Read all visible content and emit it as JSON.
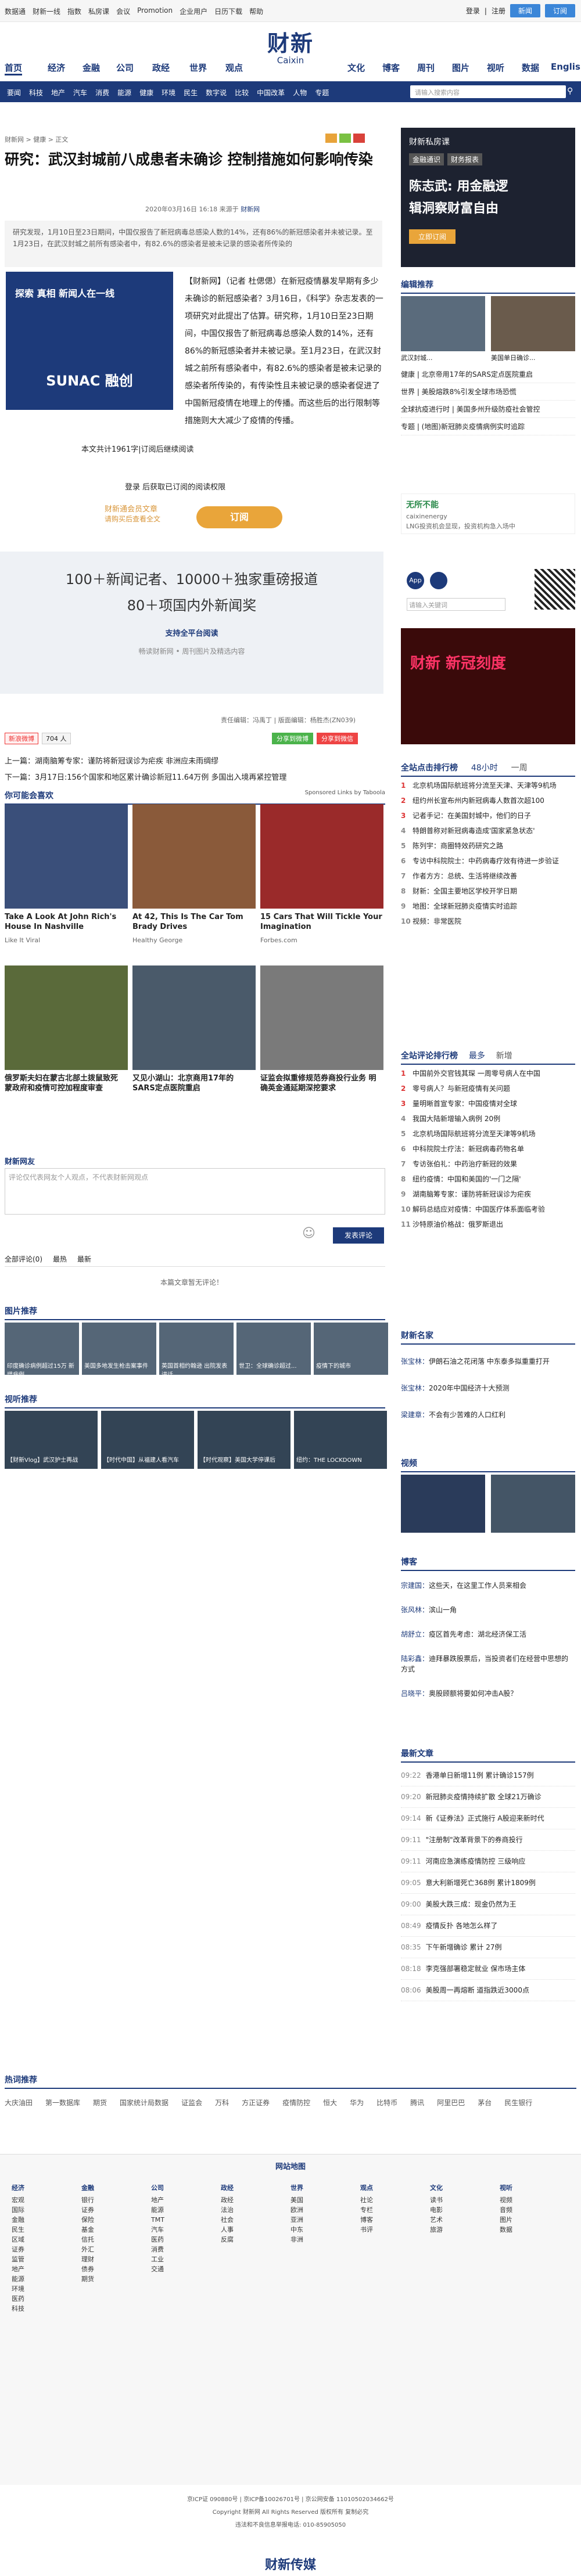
{
  "topbar": {
    "links": [
      "数据通",
      "财新一线",
      "指数",
      "私房课",
      "会议",
      "Promotion",
      "企业用户",
      "日历下载",
      "帮助"
    ],
    "login": "登录",
    "register": "注册",
    "btn1": "新闻",
    "btn2": "订阅"
  },
  "logo": {
    "cn": "财新",
    "en": "Caixin"
  },
  "nav1": [
    "首页",
    "经济",
    "金融",
    "公司",
    "政经",
    "世界",
    "观点",
    "文化",
    "博客",
    "周刊",
    "图片",
    "视听",
    "数据",
    "English"
  ],
  "nav2": {
    "items": [
      "要闻",
      "科技",
      "地产",
      "汽车",
      "消费",
      "能源",
      "健康",
      "环境",
      "民生",
      "数字说",
      "比较",
      "中国改革",
      "人物",
      "专题"
    ],
    "search_placeholder": "请输入搜索内容"
  },
  "article": {
    "breadcrumb": "财新网 > 健康 > 正文",
    "title": "研究：武汉封城前八成患者未确诊 控制措施如何影响传染",
    "meta": "2020年03月16日 16:18 来源于",
    "meta_src": "财新网",
    "summary": "研究发现，1月10日至23日期间，中国仅报告了新冠病毒总感染人数的14%，还有86%的新冠感染者并未被记录。至1月23日，在武汉封城之前所有感染者中，有82.6%的感染者是被未记录的感染者所传染的",
    "lead": "【财新网】（记者 杜偲偲）在新冠疫情暴发早期有多少未确诊的新冠感染者？3月16日，《科学》杂志发表的一项研究对此提出了估算。研究称，1月10日至23日期间，中国仅报告了新冠病毒总感染人数的14%，还有86%的新冠感染者并未被记录。至1月23日，在武汉封城之前所有感染者中，有82.6%的感染者是被未记录的感染者所传染的，有传染性且未被记录的感染者促进了中国新冠疫情在地理上的传播。而这些后的出行限制等措施则大大减少了疫情的传播。",
    "ad_text": "探索 真相 新闻人在一线",
    "ad_brand": "SUNAC 融创",
    "count_line": "本文共计1961字|订阅后继续阅读",
    "login_line": "登录 后获取已订阅的阅读权限",
    "sub_big": "财新通会员文章",
    "sub_small": "请购买后查看全文",
    "sub_btn": "订阅",
    "promo1": "100＋新闻记者、10000＋独家重磅报道",
    "promo2": "80＋项国内外新闻奖",
    "promo3": "支持全平台阅读",
    "promo4": "畅读财新网 • 周刊图片及精选内容",
    "editor": "责任编辑：冯禹丁 | 版面编辑：杨胜杰(ZN039)",
    "share1": "分享到微博",
    "share2": "分享到微信",
    "prev": "上一篇：",
    "prev_txt": "湖南脑筹专家：谨防将新冠误诊为疟疾 非洲应未雨绸缪",
    "next": "下一篇：",
    "next_txt": "3月17日:156个国家和地区累计确诊新冠11.64万例 多国出入境再紧控管理",
    "recommend": "你可能会喜欢",
    "sponsored": "Sponsored Links by Taboola"
  },
  "recs": [
    {
      "t": "Take A Look At John Rich's House In Nashville",
      "s": "Like It Viral"
    },
    {
      "t": "At 42, This Is The Car Tom Brady Drives",
      "s": "Healthy George"
    },
    {
      "t": "15 Cars That Will Tickle Your Imagination",
      "s": "Forbes.com"
    },
    {
      "t": "俄罗斯夫妇在蒙古北部土拨鼠致死 蒙政府和疫情可控加程度审查",
      "s": ""
    },
    {
      "t": "又见小湖山：北京商用17年的SARS定点医院重启",
      "s": ""
    },
    {
      "t": "证监会拟重修规范券商投行业务 明确英金通延期深挖要求",
      "s": ""
    }
  ],
  "comments": {
    "title": "财新网友",
    "placeholder": "评论仅代表网友个人观点，不代表财新网观点",
    "submit": "发表评论",
    "tabs": [
      "全部评论(0)",
      "最热",
      "最新"
    ],
    "none": "本篇文章暂无评论！"
  },
  "pic_section": "图片推荐",
  "video_section": "视听推荐",
  "pics": [
    "印度确诊病例超过15万 新增病例",
    "美国多地发生枪击案事件",
    "英国首相约翰逊 出院发表讲话",
    "世卫：全球确诊超过...",
    "疫情下的城市"
  ],
  "videos": [
    "【财新Vlog】武汉护士再战",
    "【时代中国】从福建人看汽车",
    "【时代观察】美国大学停课后",
    "纽约：THE LOCKDOWN"
  ],
  "right": {
    "ad_title": "财新私房课",
    "ad_big1": "陈志武: 用金融逻",
    "ad_big2": "辑洞察财富自由",
    "ad_badge1": "金融通识",
    "ad_badge2": "财务报表",
    "ad_btn": "立即订阅",
    "editors": "编辑推荐",
    "ed_caps": [
      "武汉封城...",
      "美国单日确诊..."
    ],
    "ed_list": [
      "健康 | 北京帝用17年的SARS定点医院重启",
      "世界 | 美股熔跌8%引发全球市场恐慌",
      "全球抗疫进行时 | 美国多州升级防疫社会管控",
      "专题 | (地图)新冠肺炎疫情病例实时追踪"
    ],
    "app": "无所不能",
    "app2": "caixinenergy",
    "app3": "LNG投资机会显现，投资机构急入场中",
    "qr_text": "请输入关键词",
    "hot_title": "财新 新冠刻度",
    "rank": "全站点击排行榜",
    "rank_tabs": [
      "48小时",
      "一周"
    ],
    "rank_list": [
      "北京机场国际航班将分流至天津、天津等9机场",
      "纽约州长宣布州内新冠病毒人数首次超100",
      "记者手记：在美国封城中，他们的日子",
      "特朗普称对新冠病毒造成'国家紧急状态'",
      "陈列宇：商圈特效药研究之路",
      "专访中科院院士：中药病毒疗效有待进一步验证",
      "作者方方：总统、生活将继续改善",
      "财新：全国主要地区学校开学日期",
      "地图：全球新冠肺炎疫情实时追踪",
      "视频：非常医院"
    ],
    "cmt_rank": "全站评论排行榜",
    "cmt_tabs": [
      "最多",
      "新增"
    ],
    "cmt_list": [
      "中国前外交官钱其琛 一周零号病人在中国",
      "零号病人？与新冠疫情有关问题",
      "量明晰首宣专家：中国疫情对全球",
      "我国大陆新增输入病例 20例",
      "北京机场国际航班将分流至天津等9机场",
      "中科院院士疗法：新冠病毒药物名单",
      "专访张伯礼：中药治疗新冠的效果",
      "纽约疫情：中国和美国的'一门之隔'",
      "湖南脑筹专家：谨防将新冠误诊为疟疾",
      "解码总结应对疫情：中国医疗体系面临考验",
      "沙特原油价格战：俄罗斯退出"
    ],
    "columnists": "财新名家",
    "col_list": [
      {
        "n": "张宝林：",
        "t": "伊朗石油之花闭落 中东泰多拟重重打开"
      },
      {
        "n": "张宝林：",
        "t": "2020年中国经济十大预测"
      },
      {
        "n": "梁建章：",
        "t": "不会有少苦难的人口红利"
      }
    ],
    "video": "视频",
    "blogs": "博客",
    "blog_list": [
      {
        "n": "宗建国：",
        "t": "这些天，在这里工作人员来相会"
      },
      {
        "n": "张风林：",
        "t": "滨山一角"
      },
      {
        "n": "胡舒立：",
        "t": "疫区首先考虑：湖北经济保工活"
      },
      {
        "n": "陆彩鑫：",
        "t": "迪拜暴跌股票后，当投资者们在经营中思想的方式"
      },
      {
        "n": "吕晓平：",
        "t": "奥股顾额将要如何冲击A股？"
      }
    ],
    "latest": "最新文章",
    "latest_list": [
      {
        "t": "09:22",
        "x": "香港单日新增11例 累计确诊157例"
      },
      {
        "t": "09:20",
        "x": "新冠肺炎疫情持续扩散 全球21万确诊"
      },
      {
        "t": "09:14",
        "x": "新《证券法》正式施行 A股迎来新时代"
      },
      {
        "t": "09:11",
        "x": "\"注册制\"改革背景下的券商投行"
      },
      {
        "t": "09:11",
        "x": "河南应急演练疫情防控 三级响应"
      },
      {
        "t": "09:05",
        "x": "意大利新增死亡368例 累计1809例"
      },
      {
        "t": "09:00",
        "x": "美股大跌三成：现金仍然为王"
      },
      {
        "t": "08:49",
        "x": "疫情反扑 各地怎么样了"
      },
      {
        "t": "08:35",
        "x": "下午新增确诊 累计 27例"
      },
      {
        "t": "08:18",
        "x": "李克强部署稳定就业 保市场主体"
      },
      {
        "t": "08:06",
        "x": "美股周一再熔断 道指跌近3000点"
      }
    ]
  },
  "hot_words": {
    "title": "热词推荐",
    "items": [
      "大庆油田",
      "第一数据库",
      "期货",
      "国家统计局数据",
      "证监会",
      "万科",
      "方正证券",
      "疫情防控",
      "恒大",
      "华为",
      "比特币",
      "腾讯",
      "阿里巴巴",
      "茅台",
      "民生银行"
    ]
  },
  "sitemap": {
    "title": "网站地图",
    "cols": [
      {
        "h": "经济",
        "i": [
          "宏观",
          "国际",
          "金融",
          "民生",
          "区域",
          "证券",
          "监管",
          "地产",
          "能源",
          "环境",
          "医药",
          "科技"
        ]
      },
      {
        "h": "金融",
        "i": [
          "银行",
          "证券",
          "保险",
          "基金",
          "信托",
          "外汇",
          "理财",
          "债券",
          "期货"
        ]
      },
      {
        "h": "公司",
        "i": [
          "地产",
          "能源",
          "TMT",
          "汽车",
          "医药",
          "消费",
          "工业",
          "交通"
        ]
      },
      {
        "h": "政经",
        "i": [
          "政经",
          "法治",
          "社会",
          "人事",
          "反腐"
        ]
      },
      {
        "h": "世界",
        "i": [
          "美国",
          "欧洲",
          "亚洲",
          "中东",
          "非洲"
        ]
      },
      {
        "h": "观点",
        "i": [
          "社论",
          "专栏",
          "博客",
          "书评"
        ]
      },
      {
        "h": "文化",
        "i": [
          "读书",
          "电影",
          "艺术",
          "旅游"
        ]
      },
      {
        "h": "视听",
        "i": [
          "视频",
          "音频",
          "图片",
          "数据"
        ]
      }
    ]
  },
  "footer": {
    "l1": "京ICP证 090880号 | 京ICP备10026701号 | 京公网安备 11010502034662号",
    "l2": "Copyright 财新网 All Rights Reserved 版权所有 复制必究",
    "l3": "违法和不良信息举报电话: 010-85905050",
    "bottom_logo": "财新传媒"
  }
}
